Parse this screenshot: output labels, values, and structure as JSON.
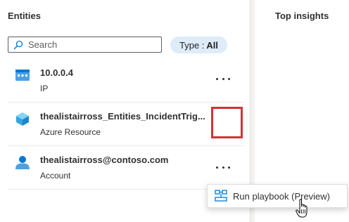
{
  "entities_panel": {
    "title": "Entities",
    "search": {
      "placeholder": "Search",
      "value": ""
    },
    "type_filter": {
      "label": "Type :",
      "value": "All"
    },
    "items": [
      {
        "name": "10.0.0.4",
        "type": "IP",
        "icon": "ip-address-icon"
      },
      {
        "name": "thealistairross_Entities_IncidentTrig...",
        "type": "Azure Resource",
        "icon": "azure-resource-cube-icon"
      },
      {
        "name": "thealistairross@contoso.com",
        "type": "Account",
        "icon": "account-user-icon"
      }
    ]
  },
  "insights_panel": {
    "title": "Top insights"
  },
  "context_menu": {
    "items": [
      {
        "label": "Run playbook (Preview)",
        "icon": "playbook-icon"
      }
    ]
  },
  "colors": {
    "accent": "#0078d4",
    "pill_background": "#deecf9",
    "highlight": "#d13438"
  }
}
